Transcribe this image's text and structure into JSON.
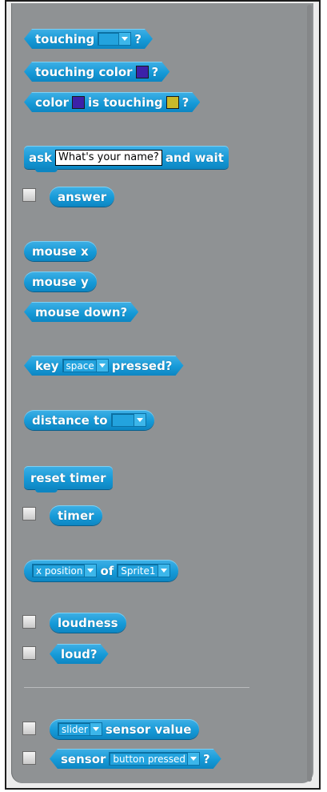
{
  "blocks": {
    "touching": {
      "label": "touching",
      "suffix": "?"
    },
    "touching_color": {
      "label": "touching color",
      "suffix": "?",
      "swatch_color": "#3c21a8"
    },
    "color_is_touching": {
      "label_a": "color",
      "label_b": "is touching",
      "suffix": "?",
      "swatch_a": "#3c21a8",
      "swatch_b": "#c9b92a"
    },
    "ask": {
      "label_a": "ask",
      "field_value": "What's your name?",
      "label_b": "and wait"
    },
    "answer": {
      "label": "answer"
    },
    "mouse_x": {
      "label": "mouse x"
    },
    "mouse_y": {
      "label": "mouse y"
    },
    "mouse_down": {
      "label": "mouse down?"
    },
    "key_pressed": {
      "label_a": "key",
      "dropdown_value": "space",
      "label_b": "pressed?"
    },
    "distance_to": {
      "label": "distance to"
    },
    "reset_timer": {
      "label": "reset timer"
    },
    "timer": {
      "label": "timer"
    },
    "of": {
      "attr_value": "x position",
      "label": "of",
      "sprite_value": "Sprite1"
    },
    "loudness": {
      "label": "loudness"
    },
    "loud": {
      "label": "loud?"
    },
    "sensor_value": {
      "dropdown_value": "slider",
      "label": "sensor value"
    },
    "sensor": {
      "label": "sensor",
      "dropdown_value": "button pressed",
      "suffix": "?"
    }
  },
  "colors": {
    "block": "#169ad8",
    "palette_bg": "#8f9294"
  }
}
